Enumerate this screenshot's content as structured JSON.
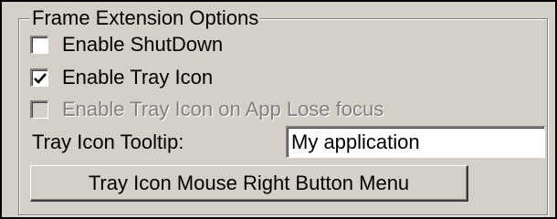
{
  "group": {
    "title": "Frame Extension Options"
  },
  "options": [
    {
      "label": "Enable ShutDown",
      "checked": false,
      "enabled": true
    },
    {
      "label": "Enable Tray Icon",
      "checked": true,
      "enabled": true
    },
    {
      "label": "Enable Tray Icon on App Lose focus",
      "checked": false,
      "enabled": false
    }
  ],
  "tooltip": {
    "label": "Tray Icon Tooltip:",
    "value": "My application"
  },
  "menu_button": {
    "label": "Tray Icon Mouse Right Button Menu"
  },
  "colors": {
    "face": "#d4d0c8",
    "shadow": "#808080",
    "highlight": "#ffffff",
    "disabled_text": "#808080"
  },
  "icons": {
    "checked": "checkmark-icon"
  }
}
